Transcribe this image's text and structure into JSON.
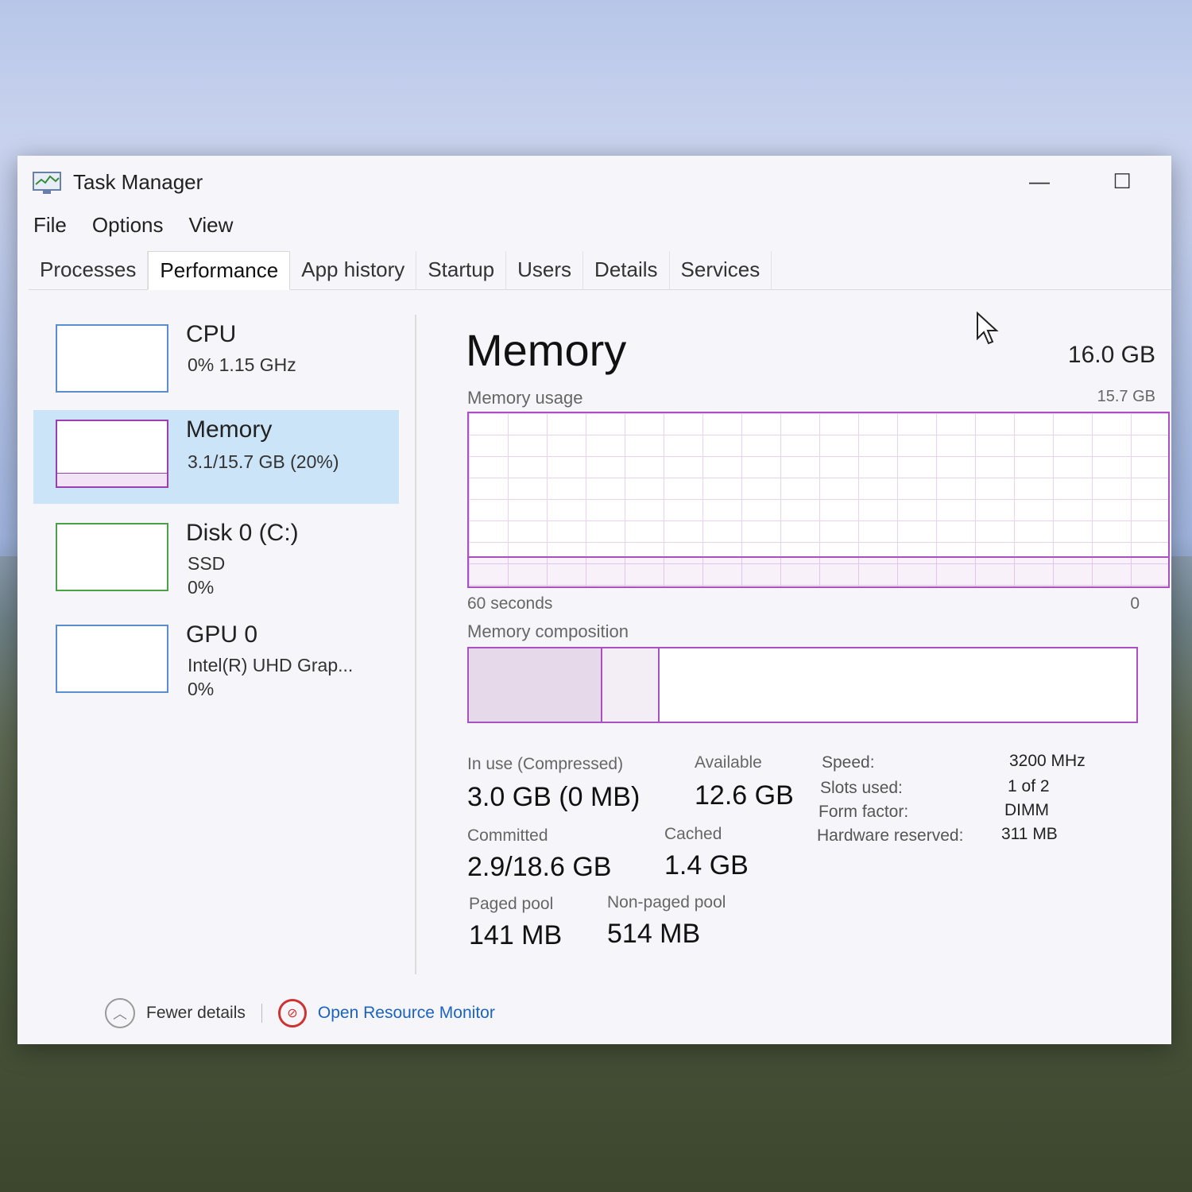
{
  "window": {
    "title": "Task Manager",
    "minimize_glyph": "—",
    "maximize_glyph": "☐"
  },
  "menu": [
    "File",
    "Options",
    "View"
  ],
  "tabs": [
    "Processes",
    "Performance",
    "App history",
    "Startup",
    "Users",
    "Details",
    "Services"
  ],
  "active_tab": "Performance",
  "sidebar": {
    "cpu": {
      "name": "CPU",
      "line1": "0%  1.15 GHz"
    },
    "memory": {
      "name": "Memory",
      "line1": "3.1/15.7 GB (20%)",
      "usage_fraction": 0.2
    },
    "disk": {
      "name": "Disk 0 (C:)",
      "line1": "SSD",
      "line2": "0%"
    },
    "gpu": {
      "name": "GPU 0",
      "line1": "Intel(R) UHD Grap...",
      "line2": "0%"
    }
  },
  "main": {
    "title": "Memory",
    "total": "16.0 GB",
    "usage_label": "Memory usage",
    "usage_max": "15.7 GB",
    "axis_left": "60 seconds",
    "axis_right": "0",
    "composition_label": "Memory composition",
    "stats": {
      "in_use_label": "In use (Compressed)",
      "in_use_value": "3.0 GB (0 MB)",
      "available_label": "Available",
      "available_value": "12.6 GB",
      "committed_label": "Committed",
      "committed_value": "2.9/18.6 GB",
      "cached_label": "Cached",
      "cached_value": "1.4 GB",
      "paged_label": "Paged pool",
      "paged_value": "141 MB",
      "nonpaged_label": "Non-paged pool",
      "nonpaged_value": "514 MB"
    },
    "specs": {
      "speed_label": "Speed:",
      "speed_value": "3200 MHz",
      "slots_label": "Slots used:",
      "slots_value": "1 of 2",
      "form_label": "Form factor:",
      "form_value": "DIMM",
      "hw_label": "Hardware reserved:",
      "hw_value": "311 MB"
    }
  },
  "footer": {
    "fewer_details": "Fewer details",
    "open_monitor": "Open Resource Monitor"
  },
  "colors": {
    "memory_accent": "#a950c2",
    "selected_bg": "#cce4f7",
    "link": "#1a63c4"
  }
}
